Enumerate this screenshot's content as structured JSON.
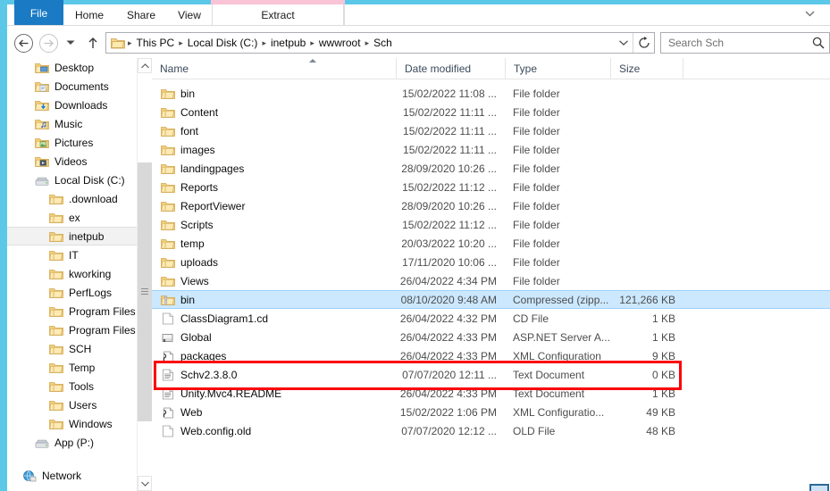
{
  "window": {
    "border_color": "#5bc8e8",
    "contextual_band_color": "#f9c4d6"
  },
  "ribbon": {
    "tabs": [
      {
        "label": "File",
        "id": "file"
      },
      {
        "label": "Home",
        "id": "home"
      },
      {
        "label": "Share",
        "id": "share"
      },
      {
        "label": "View",
        "id": "view"
      },
      {
        "label": "Extract",
        "id": "extract"
      }
    ],
    "expand_icon": "chevron-down-icon",
    "expand_glyph": "⌄"
  },
  "navbar": {
    "back_glyph": "←",
    "forward_glyph": "→",
    "history_glyph": "▾",
    "up_glyph": "↑",
    "breadcrumbs": [
      "This PC",
      "Local Disk (C:)",
      "inetpub",
      "wwwroot",
      "Sch"
    ],
    "separator_glyph": "▸",
    "address_dropdown_glyph": "⌄",
    "refresh_glyph": "↻",
    "search_placeholder": "Search Sch",
    "search_icon": "magnifier-icon"
  },
  "sidebar": {
    "scroll_up_glyph": "⌃",
    "scroll_down_glyph": "⌄",
    "items": [
      {
        "label": "Desktop",
        "icon": "desktop-folder-icon",
        "indent": 1,
        "selected": false
      },
      {
        "label": "Documents",
        "icon": "documents-folder-icon",
        "indent": 1,
        "selected": false
      },
      {
        "label": "Downloads",
        "icon": "downloads-folder-icon",
        "indent": 1,
        "selected": false
      },
      {
        "label": "Music",
        "icon": "music-folder-icon",
        "indent": 1,
        "selected": false
      },
      {
        "label": "Pictures",
        "icon": "pictures-folder-icon",
        "indent": 1,
        "selected": false
      },
      {
        "label": "Videos",
        "icon": "videos-folder-icon",
        "indent": 1,
        "selected": false
      },
      {
        "label": "Local Disk (C:)",
        "icon": "drive-icon",
        "indent": 1,
        "selected": false
      },
      {
        "label": ".download",
        "icon": "folder-icon",
        "indent": 2,
        "selected": false
      },
      {
        "label": "ex",
        "icon": "folder-icon",
        "indent": 2,
        "selected": false
      },
      {
        "label": "inetpub",
        "icon": "folder-icon",
        "indent": 2,
        "selected": true
      },
      {
        "label": "IT",
        "icon": "folder-icon",
        "indent": 2,
        "selected": false
      },
      {
        "label": "kworking",
        "icon": "folder-icon",
        "indent": 2,
        "selected": false
      },
      {
        "label": "PerfLogs",
        "icon": "folder-icon",
        "indent": 2,
        "selected": false
      },
      {
        "label": "Program Files",
        "icon": "folder-icon",
        "indent": 2,
        "selected": false
      },
      {
        "label": "Program Files (",
        "icon": "folder-icon",
        "indent": 2,
        "selected": false
      },
      {
        "label": "SCH",
        "icon": "folder-icon",
        "indent": 2,
        "selected": false
      },
      {
        "label": "Temp",
        "icon": "folder-icon",
        "indent": 2,
        "selected": false
      },
      {
        "label": "Tools",
        "icon": "folder-icon",
        "indent": 2,
        "selected": false
      },
      {
        "label": "Users",
        "icon": "folder-icon",
        "indent": 2,
        "selected": false
      },
      {
        "label": "Windows",
        "icon": "folder-icon",
        "indent": 2,
        "selected": false
      },
      {
        "label": "App (P:)",
        "icon": "drive-icon",
        "indent": 1,
        "selected": false
      }
    ],
    "network": {
      "label": "Network",
      "icon": "network-icon"
    }
  },
  "filelist": {
    "columns": [
      {
        "key": "name",
        "label": "Name",
        "sorted": true
      },
      {
        "key": "date",
        "label": "Date modified",
        "sorted": false
      },
      {
        "key": "type",
        "label": "Type",
        "sorted": false
      },
      {
        "key": "size",
        "label": "Size",
        "sorted": false
      }
    ],
    "rows": [
      {
        "name": "bin",
        "date": "15/02/2022 11:08 ...",
        "type": "File folder",
        "size": "",
        "icon": "folder-icon",
        "selected": false
      },
      {
        "name": "Content",
        "date": "15/02/2022 11:11 ...",
        "type": "File folder",
        "size": "",
        "icon": "folder-icon",
        "selected": false
      },
      {
        "name": "font",
        "date": "15/02/2022 11:11 ...",
        "type": "File folder",
        "size": "",
        "icon": "folder-icon",
        "selected": false
      },
      {
        "name": "images",
        "date": "15/02/2022 11:11 ...",
        "type": "File folder",
        "size": "",
        "icon": "folder-icon",
        "selected": false
      },
      {
        "name": "landingpages",
        "date": "28/09/2020 10:26 ...",
        "type": "File folder",
        "size": "",
        "icon": "folder-icon",
        "selected": false
      },
      {
        "name": "Reports",
        "date": "15/02/2022 11:12 ...",
        "type": "File folder",
        "size": "",
        "icon": "folder-icon",
        "selected": false
      },
      {
        "name": "ReportViewer",
        "date": "28/09/2020 10:26 ...",
        "type": "File folder",
        "size": "",
        "icon": "folder-icon",
        "selected": false
      },
      {
        "name": "Scripts",
        "date": "15/02/2022 11:12 ...",
        "type": "File folder",
        "size": "",
        "icon": "folder-icon",
        "selected": false
      },
      {
        "name": "temp",
        "date": "20/03/2022 10:20 ...",
        "type": "File folder",
        "size": "",
        "icon": "folder-icon",
        "selected": false
      },
      {
        "name": "uploads",
        "date": "17/11/2020 10:06 ...",
        "type": "File folder",
        "size": "",
        "icon": "folder-icon",
        "selected": false
      },
      {
        "name": "Views",
        "date": "26/04/2022 4:34 PM",
        "type": "File folder",
        "size": "",
        "icon": "folder-icon",
        "selected": false
      },
      {
        "name": "bin",
        "date": "08/10/2020 9:48 AM",
        "type": "Compressed (zipp...",
        "size": "121,266 KB",
        "icon": "zip-folder-icon",
        "selected": true
      },
      {
        "name": "ClassDiagram1.cd",
        "date": "26/04/2022 4:32 PM",
        "type": "CD File",
        "size": "1 KB",
        "icon": "blank-file-icon",
        "selected": false
      },
      {
        "name": "Global",
        "date": "26/04/2022 4:33 PM",
        "type": "ASP.NET Server A...",
        "size": "1 KB",
        "icon": "aspnet-file-icon",
        "selected": false
      },
      {
        "name": "packages",
        "date": "26/04/2022 4:33 PM",
        "type": "XML Configuration",
        "size": "9 KB",
        "icon": "xml-file-icon",
        "selected": false
      },
      {
        "name": "Schv2.3.8.0",
        "date": "07/07/2020 12:11 ...",
        "type": "Text Document",
        "size": "0 KB",
        "icon": "text-file-icon",
        "selected": false
      },
      {
        "name": "Unity.Mvc4.README",
        "date": "26/04/2022 4:33 PM",
        "type": "Text Document",
        "size": "1 KB",
        "icon": "text-file-icon",
        "selected": false
      },
      {
        "name": "Web",
        "date": "15/02/2022 1:06 PM",
        "type": "XML Configuratio...",
        "size": "49 KB",
        "icon": "xml-file-icon",
        "selected": false
      },
      {
        "name": "Web.config.old",
        "date": "07/07/2020 12:12 ...",
        "type": "OLD File",
        "size": "48 KB",
        "icon": "blank-file-icon",
        "selected": false
      }
    ]
  },
  "annotation": {
    "shape": "rectangle",
    "color": "#fb0007",
    "target_row_name": "Schv2.3.8.0"
  }
}
